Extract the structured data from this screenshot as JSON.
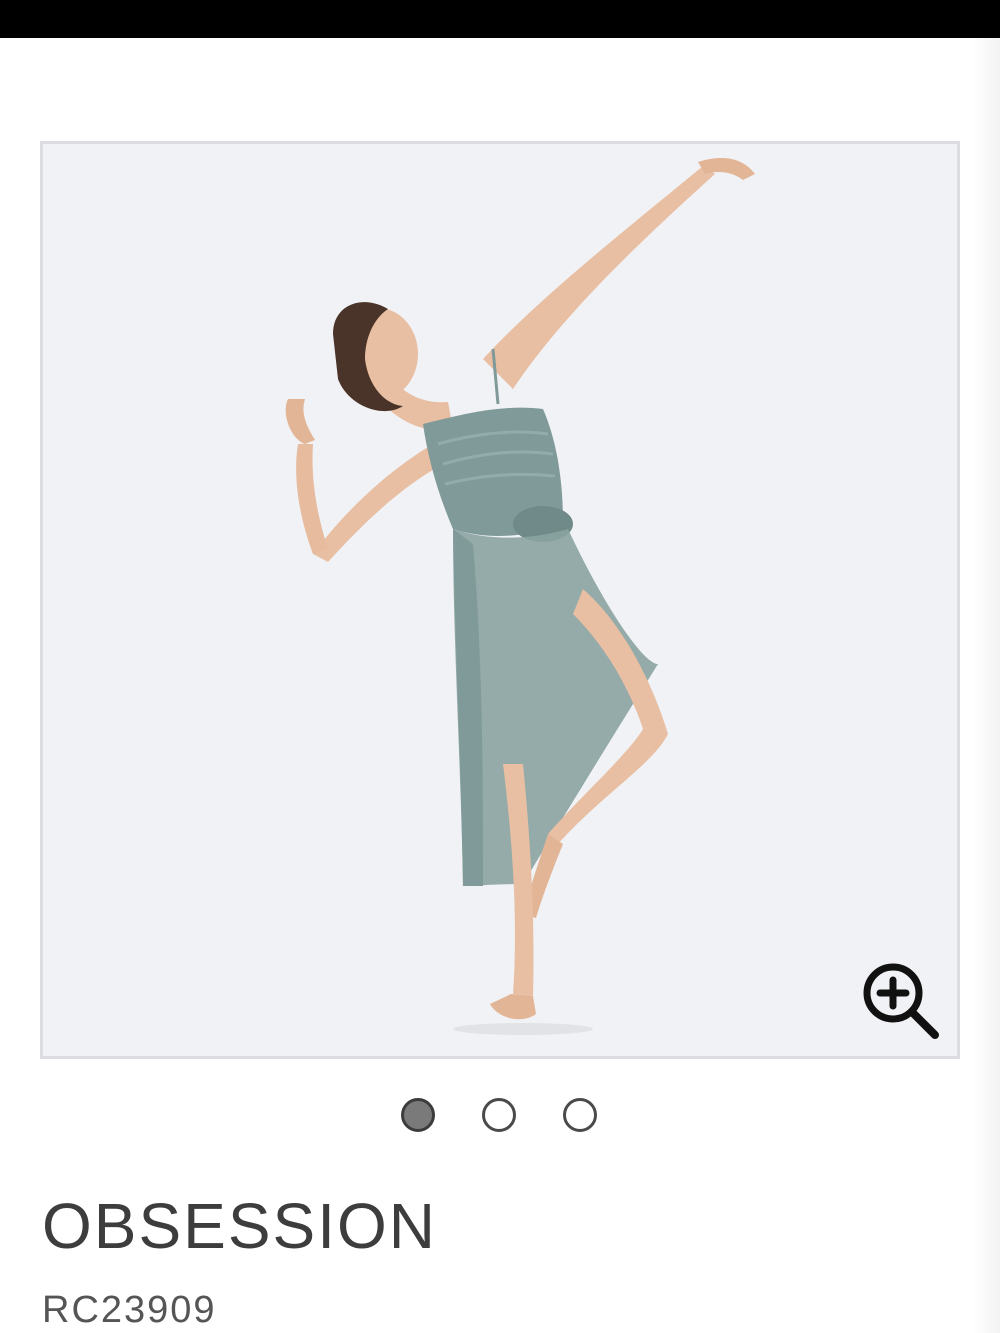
{
  "product": {
    "title": "OBSESSION",
    "sku": "RC23909"
  },
  "gallery": {
    "image_count": 3,
    "active_index": 0,
    "zoom_icon": "zoom-in-icon",
    "dress_color": "#7f9a98",
    "background_color": "#f1f2f5"
  },
  "colors": {
    "status_bar": "#000000",
    "text_primary": "#3d3d3d",
    "dot_active": "#7a7a7a"
  }
}
